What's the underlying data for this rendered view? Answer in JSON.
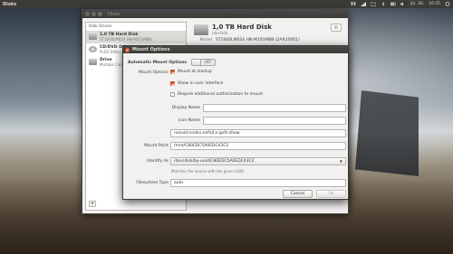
{
  "topbar": {
    "title": "Disks",
    "clock": "10:35",
    "date": "jūl. 30,"
  },
  "disks_window": {
    "title": "Disks",
    "drive_list_header": "Disk Drives",
    "drives": [
      {
        "name": "1,0 TB Hard Disk",
        "sub": "ST1000LM024 HN-M101MBB"
      },
      {
        "name": "CD/DVD Drive",
        "sub": "PLDS DVD+-RW DS-8A8SH"
      },
      {
        "name": "Drive",
        "sub": "Multiple Card Reader"
      }
    ],
    "detail": {
      "title": "1,0 TB Hard Disk",
      "subtitle": "/dev/sda",
      "model_label": "Model",
      "model_value": "ST1000LM024 HN-M101MBB (2AR10001)"
    }
  },
  "dialog": {
    "title": "Mount Options",
    "automatic_label": "Automatic Mount Options",
    "toggle_state": "OFF",
    "mount_options_label": "Mount Options",
    "checkboxes": [
      {
        "label": "Mount at startup",
        "checked": true
      },
      {
        "label": "Show in user interface",
        "checked": true
      },
      {
        "label": "Require additional authorization to mount",
        "checked": false
      }
    ],
    "display_name_label": "Display Name",
    "display_name_value": "",
    "icon_name_label": "Icon Name",
    "icon_name_value": "",
    "options_value": "nosuid,nodev,nofail,x-gvfs-show",
    "mount_point_label": "Mount Point",
    "mount_point_value": "/mnt/C80EDC5A0EDC43C2",
    "identify_as_label": "Identify As",
    "identify_as_value": "/dev/disk/by-uuid/C80EDC5A0EDC43C2",
    "identify_hint": "Matches the device with the given UUID",
    "fs_type_label": "Filesystem Type",
    "fs_type_value": "auto",
    "cancel_label": "Cancel",
    "ok_label": "OK"
  }
}
